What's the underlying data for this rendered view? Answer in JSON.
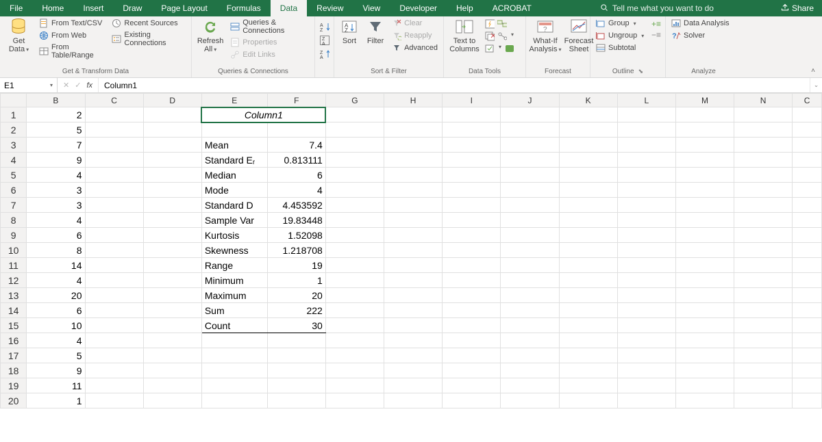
{
  "menu": {
    "tabs": [
      "File",
      "Home",
      "Insert",
      "Draw",
      "Page Layout",
      "Formulas",
      "Data",
      "Review",
      "View",
      "Developer",
      "Help",
      "ACROBAT"
    ],
    "active": "Data",
    "tell_me": "Tell me what you want to do",
    "share": "Share"
  },
  "ribbon": {
    "groups": {
      "get_transform": {
        "title": "Get & Transform Data",
        "get_data": "Get\nData",
        "from_text_csv": "From Text/CSV",
        "from_web": "From Web",
        "from_table": "From Table/Range",
        "recent_sources": "Recent Sources",
        "existing_conn": "Existing Connections"
      },
      "queries": {
        "title": "Queries & Connections",
        "refresh_all": "Refresh\nAll",
        "queries_conn": "Queries & Connections",
        "properties": "Properties",
        "edit_links": "Edit Links"
      },
      "sort_filter": {
        "title": "Sort & Filter",
        "sort": "Sort",
        "filter": "Filter",
        "clear": "Clear",
        "reapply": "Reapply",
        "advanced": "Advanced"
      },
      "data_tools": {
        "title": "Data Tools",
        "text_to_columns": "Text to\nColumns"
      },
      "forecast": {
        "title": "Forecast",
        "what_if": "What-If\nAnalysis",
        "forecast_sheet": "Forecast\nSheet"
      },
      "outline": {
        "title": "Outline",
        "group": "Group",
        "ungroup": "Ungroup",
        "subtotal": "Subtotal"
      },
      "analyze": {
        "title": "Analyze",
        "data_analysis": "Data Analysis",
        "solver": "Solver"
      }
    }
  },
  "formula_bar": {
    "name_box": "E1",
    "fx": "fx",
    "value": "Column1"
  },
  "columns": [
    "B",
    "C",
    "D",
    "E",
    "F",
    "G",
    "H",
    "I",
    "J",
    "K",
    "L",
    "M",
    "N",
    "C"
  ],
  "rows": [
    {
      "n": 1,
      "B": "2",
      "E": "Column1",
      "F": "",
      "hdr": true
    },
    {
      "n": 2,
      "B": "5",
      "E": "",
      "F": ""
    },
    {
      "n": 3,
      "B": "7",
      "E": "Mean",
      "F": "7.4"
    },
    {
      "n": 4,
      "B": "9",
      "E": "Standard Eᵣ",
      "F": "0.813111"
    },
    {
      "n": 5,
      "B": "4",
      "E": "Median",
      "F": "6"
    },
    {
      "n": 6,
      "B": "3",
      "E": "Mode",
      "F": "4"
    },
    {
      "n": 7,
      "B": "3",
      "E": "Standard D",
      "F": "4.453592"
    },
    {
      "n": 8,
      "B": "4",
      "E": "Sample Var",
      "F": "19.83448"
    },
    {
      "n": 9,
      "B": "6",
      "E": "Kurtosis",
      "F": "1.52098"
    },
    {
      "n": 10,
      "B": "8",
      "E": "Skewness",
      "F": "1.218708"
    },
    {
      "n": 11,
      "B": "14",
      "E": "Range",
      "F": "19"
    },
    {
      "n": 12,
      "B": "4",
      "E": "Minimum",
      "F": "1"
    },
    {
      "n": 13,
      "B": "20",
      "E": "Maximum",
      "F": "20"
    },
    {
      "n": 14,
      "B": "6",
      "E": "Sum",
      "F": "222"
    },
    {
      "n": 15,
      "B": "10",
      "E": "Count",
      "F": "30",
      "last": true
    },
    {
      "n": 16,
      "B": "4",
      "E": "",
      "F": ""
    },
    {
      "n": 17,
      "B": "5",
      "E": "",
      "F": ""
    },
    {
      "n": 18,
      "B": "9",
      "E": "",
      "F": ""
    },
    {
      "n": 19,
      "B": "11",
      "E": "",
      "F": ""
    },
    {
      "n": 20,
      "B": "1",
      "E": "",
      "F": ""
    }
  ],
  "active_cell": "E1"
}
